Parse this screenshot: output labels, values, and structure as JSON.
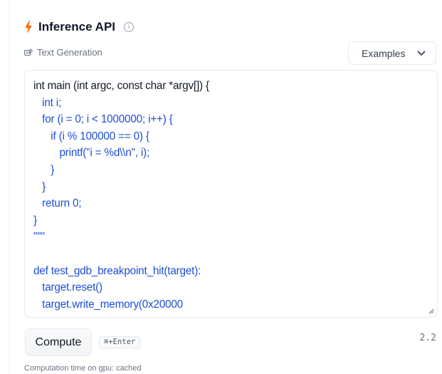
{
  "widget": {
    "title": "Inference API",
    "title_icon": "lightning-bolt-icon",
    "accent_color": "#f97316"
  },
  "task": {
    "icon": "text-generation-icon",
    "label": "Text Generation"
  },
  "examples": {
    "label": "Examples",
    "icon": "chevron-down-icon"
  },
  "editor": {
    "prompt_lines": [
      "int main (int argc, const char *argv[]) {"
    ],
    "generated_lines": [
      "   int i;",
      "   for (i = 0; i < 1000000; i++) {",
      "      if (i % 100000 == 0) {",
      "         printf(\"i = %d\\\\n\", i);",
      "      }",
      "   }",
      "   return 0;",
      "}",
      "\"\"\"",
      "",
      "def test_gdb_breakpoint_hit(target):",
      "   target.reset()",
      "   target.write_memory(0x20000"
    ],
    "prompt_color": "#111827",
    "generated_color": "#1d4ed8"
  },
  "actions": {
    "compute_label": "Compute",
    "shortcut_label": "⌘+Enter",
    "version": "2.2"
  },
  "footer": {
    "computation_time": "Computation time on gpu: cached"
  }
}
